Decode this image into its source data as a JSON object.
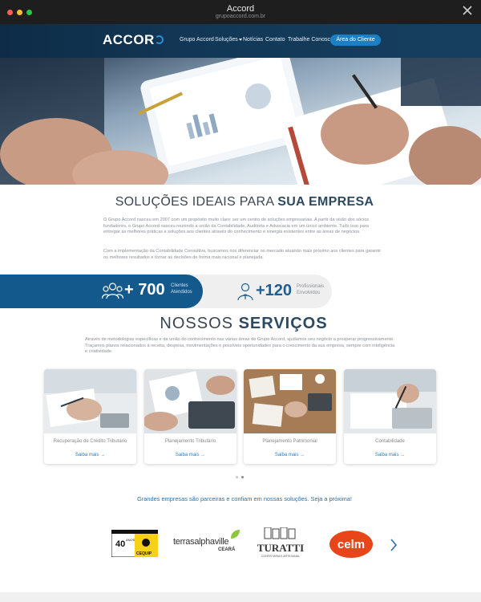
{
  "window": {
    "title": "Accord",
    "url": "grupoaccord.com.br"
  },
  "nav": {
    "logo": "ACCOR",
    "links": [
      "Grupo Accord",
      "Soluções",
      "Notícias",
      "Contato",
      "Trabalhe Conosco"
    ],
    "client_button": "Área do Cliente"
  },
  "intro": {
    "heading_light": "SOLUÇÕES IDEAIS PARA ",
    "heading_bold": "SUA EMPRESA",
    "p1": "O Grupo Accord nasceu em 2007 com um propósito muito claro: ser um centro de soluções empresariais. A partir da visão dos sócios fundadores, o Grupo Accord nasceu reunindo a união da Contabilidade, Auditoria e Advocacia em um único ambiente. Tudo isso para entregar as melhores práticas e soluções aos clientes através do conhecimento e sinergia existentes entre as áreas de negócios.",
    "p2": "Com a implementação da Contabilidade Consultiva, buscamos nos diferenciar no mercado atuando mais próximo aos clientes para garantir os melhores resultados e tornar as decisões de forma mais racional e planejada."
  },
  "stats": [
    {
      "number": "+ 700",
      "label_line1": "Clientes",
      "label_line2": "Atendidos",
      "icon": "people-group-icon"
    },
    {
      "number": "+120",
      "label_line1": "Profissionais",
      "label_line2": "Envolvidos",
      "icon": "professional-icon"
    }
  ],
  "services": {
    "heading_light": "NOSSOS ",
    "heading_bold": "SERVIÇOS",
    "description": "Através de metodologias específicas e da união do conhecimento nas várias áreas do Grupo Accord, ajudamos seu negócio a prosperar progressivamente. Traçamos planos relacionados à receita, despesa, movimentações e possíveis oportunidades para o crescimento da sua empresa, sempre com inteligência e criatividade.",
    "cards": [
      {
        "title": "Recuperação de Crédito Tributário",
        "link": "Saiba mais →"
      },
      {
        "title": "Planejamento Tributário",
        "link": "Saiba mais →"
      },
      {
        "title": "Planejamento Patrimonial",
        "link": "Saiba mais →"
      },
      {
        "title": "Contabilidade",
        "link": "Saiba mais →"
      }
    ],
    "pager_active": 2,
    "pager_count": 2
  },
  "partners": {
    "tagline": "Grandes empresas são parceiras e confiam em nossas soluções. Seja a próxima!",
    "logos": [
      {
        "name": "CEQUIP",
        "text_top": "40",
        "text_sub": "ANOS"
      },
      {
        "name": "terrasalphaville",
        "text_main": "terrasalphaville",
        "text_sub": "CEARÁ"
      },
      {
        "name": "TURATTI",
        "text_main": "TURATTI",
        "text_sub": "CONFEITARIA E ARTESANAL"
      },
      {
        "name": "celm",
        "text_main": "celm"
      }
    ]
  },
  "colors": {
    "nav_bg": "#123756",
    "accent": "#1c7fc4",
    "stat_dark": "#14598b",
    "heading": "#2e4a63"
  }
}
